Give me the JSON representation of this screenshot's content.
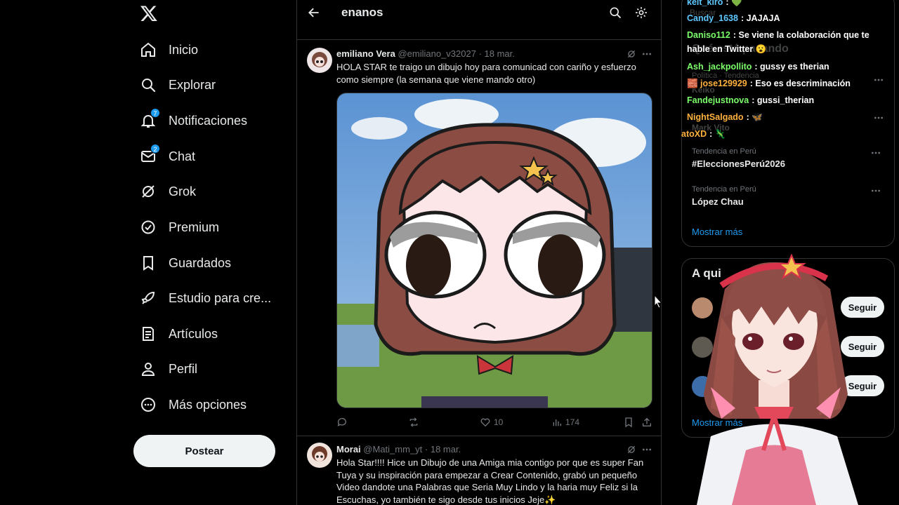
{
  "sidebar": {
    "logo": "x-logo-icon",
    "items": [
      {
        "label": "Inicio",
        "icon": "home-icon"
      },
      {
        "label": "Explorar",
        "icon": "search-icon"
      },
      {
        "label": "Notificaciones",
        "icon": "bell-icon",
        "badge": "7"
      },
      {
        "label": "Chat",
        "icon": "mail-icon",
        "badge": "2"
      },
      {
        "label": "Grok",
        "icon": "grok-icon"
      },
      {
        "label": "Premium",
        "icon": "verified-icon"
      },
      {
        "label": "Guardados",
        "icon": "bookmark-icon"
      },
      {
        "label": "Estudio para cre...",
        "icon": "rocket-icon"
      },
      {
        "label": "Artículos",
        "icon": "article-icon"
      },
      {
        "label": "Perfil",
        "icon": "person-icon"
      },
      {
        "label": "Más opciones",
        "icon": "more-circle-icon"
      }
    ],
    "post_label": "Postear"
  },
  "header": {
    "search_term": "enanos"
  },
  "tweets": [
    {
      "name": "emiliano Vera",
      "handle": "@emiliano_v32027",
      "date": "· 18 mar.",
      "text": "HOLA STAR te traigo un dibujo hoy para comunicad con cariño y esfuerzo como siempre (la semana que viene mando otro)",
      "likes": "10",
      "views": "174"
    },
    {
      "name": "Morai",
      "handle": "@Mati_mm_yt",
      "date": "· 18 mar.",
      "text": "Hola Star!!!! Hice un Dibujo de una Amiga mia contigo por que es super Fan Tuya y su inspiración para empezar a Crear Contenido, grabó un pequeño Video dandote una Palabras que Seria Muy Lindo y la haria muy Feliz si la Escuchas, yo también te sigo desde tus inicios Jeje✨"
    }
  ],
  "trends": [
    {
      "category": "Tendencia en Perú",
      "name": "#EleccionesPerú2026"
    },
    {
      "category": "Tendencia en Perú",
      "name": "López Chau"
    }
  ],
  "trends_show_more": "Mostrar más",
  "follow": {
    "title": "A qui",
    "button_label": "Seguir",
    "show_more": "Mostrar más"
  },
  "ghost_text": {
    "search": "Buscar",
    "trending_title": "Qué está pasando",
    "cat1": "Política · Tendencia",
    "name1": "Keiko",
    "name2": "Mark Vito"
  },
  "chat": [
    {
      "user": "keit_kiro",
      "msg": ": 💚",
      "color": "#5ec8ff"
    },
    {
      "user": "Candy_1638",
      "msg": ": JAJAJA",
      "color": "#5ec8ff"
    },
    {
      "user": "Daniso112",
      "msg": ": Se viene la colaboración que te hable en Twitter 😮",
      "color": "#7cff6b"
    },
    {
      "user": "Ash_jackpollito",
      "msg": ": gussy es therian",
      "color": "#7cff6b"
    },
    {
      "user": "🧱 jose129929",
      "msg": ": Eso es descriminación",
      "color": "#ffb13d"
    },
    {
      "user": "Fandejustnova",
      "msg": ": gussi_therian",
      "color": "#7cff6b"
    },
    {
      "user": "NightSalgado",
      "msg": ": 🦋",
      "color": "#ffb13d"
    },
    {
      "user": "atoXD",
      "msg": ": 🦎",
      "color": "#ffb13d"
    }
  ],
  "colors": {
    "accent": "#1d9bf0",
    "background": "#000000",
    "border": "#2f3336",
    "muted": "#71767b"
  }
}
